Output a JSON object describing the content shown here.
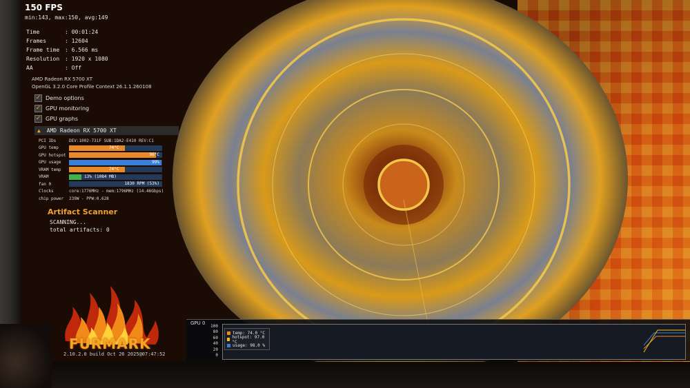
{
  "stats": {
    "fps_title": "150 FPS",
    "minmax": "min:143, max:150, avg:149",
    "rows": [
      {
        "key": "Time",
        "value": ": 00:01:24"
      },
      {
        "key": "Frames",
        "value": ": 12604"
      },
      {
        "key": "Frame time",
        "value": ": 6.566 ms"
      },
      {
        "key": "Resolution",
        "value": ": 1920 x 1080"
      },
      {
        "key": "AA",
        "value": ": Off"
      }
    ],
    "gpu_name": "AMD Radeon RX 5700 XT",
    "opengl": "OpenGL 3.2.0 Core Profile Context 26.1.1.260108"
  },
  "options": [
    {
      "label": "Demo options",
      "checked": true
    },
    {
      "label": "GPU monitoring",
      "checked": true
    },
    {
      "label": "GPU graphs",
      "checked": true
    }
  ],
  "gpu_panel": {
    "header": "AMD Radeon RX 5700 XT",
    "pci_label": "PCI IDs",
    "pci_value": "DEV:1002-731F SUB:1DA2-E410 REV:C1",
    "gpu_temp_label": "GPU temp",
    "gpu_temp_text": "74°C",
    "gpu_temp_level": 0.6,
    "hotspot_label": "GPU hotspot",
    "hotspot_text": "96°C",
    "hotspot_level": 0.93,
    "usage_label": "GPU usage",
    "usage_text": "99%",
    "usage_level": 0.99,
    "vram_temp_label": "VRAM temp",
    "vram_temp_text": "74°C",
    "vram_temp_level": 0.6,
    "vram_label": "VRAM",
    "vram_text": "13% (1084 MB)",
    "vram_level": 0.13,
    "fan_label": "fan 0",
    "fan_text": "1830 RPM (53%)",
    "fan_level": 0.0,
    "clocks_label": "Clocks",
    "clocks_value": "core:1776MHz - mem:1796MHz (14.46Gbps)",
    "power_label": "chip power",
    "power_value": "239W - PPW:0.628"
  },
  "artifact": {
    "title": "Artifact Scanner",
    "status": "SCANNING...",
    "total": "total artifacts: 0"
  },
  "logo": {
    "text": "FURMARK",
    "build": "2.10.2.0 build Oct 26 2025@07:47:52"
  },
  "graph": {
    "label": "GPU 0",
    "yticks": [
      "100",
      "80",
      "60",
      "40",
      "20",
      "0"
    ],
    "legend": [
      {
        "text": "temp: 74.0 °C",
        "color": "#e8892a"
      },
      {
        "text": "hotspot: 97.0 °C",
        "color": "#f0c020"
      },
      {
        "text": "usage: 98.0 %",
        "color": "#3a7fd6"
      }
    ]
  }
}
